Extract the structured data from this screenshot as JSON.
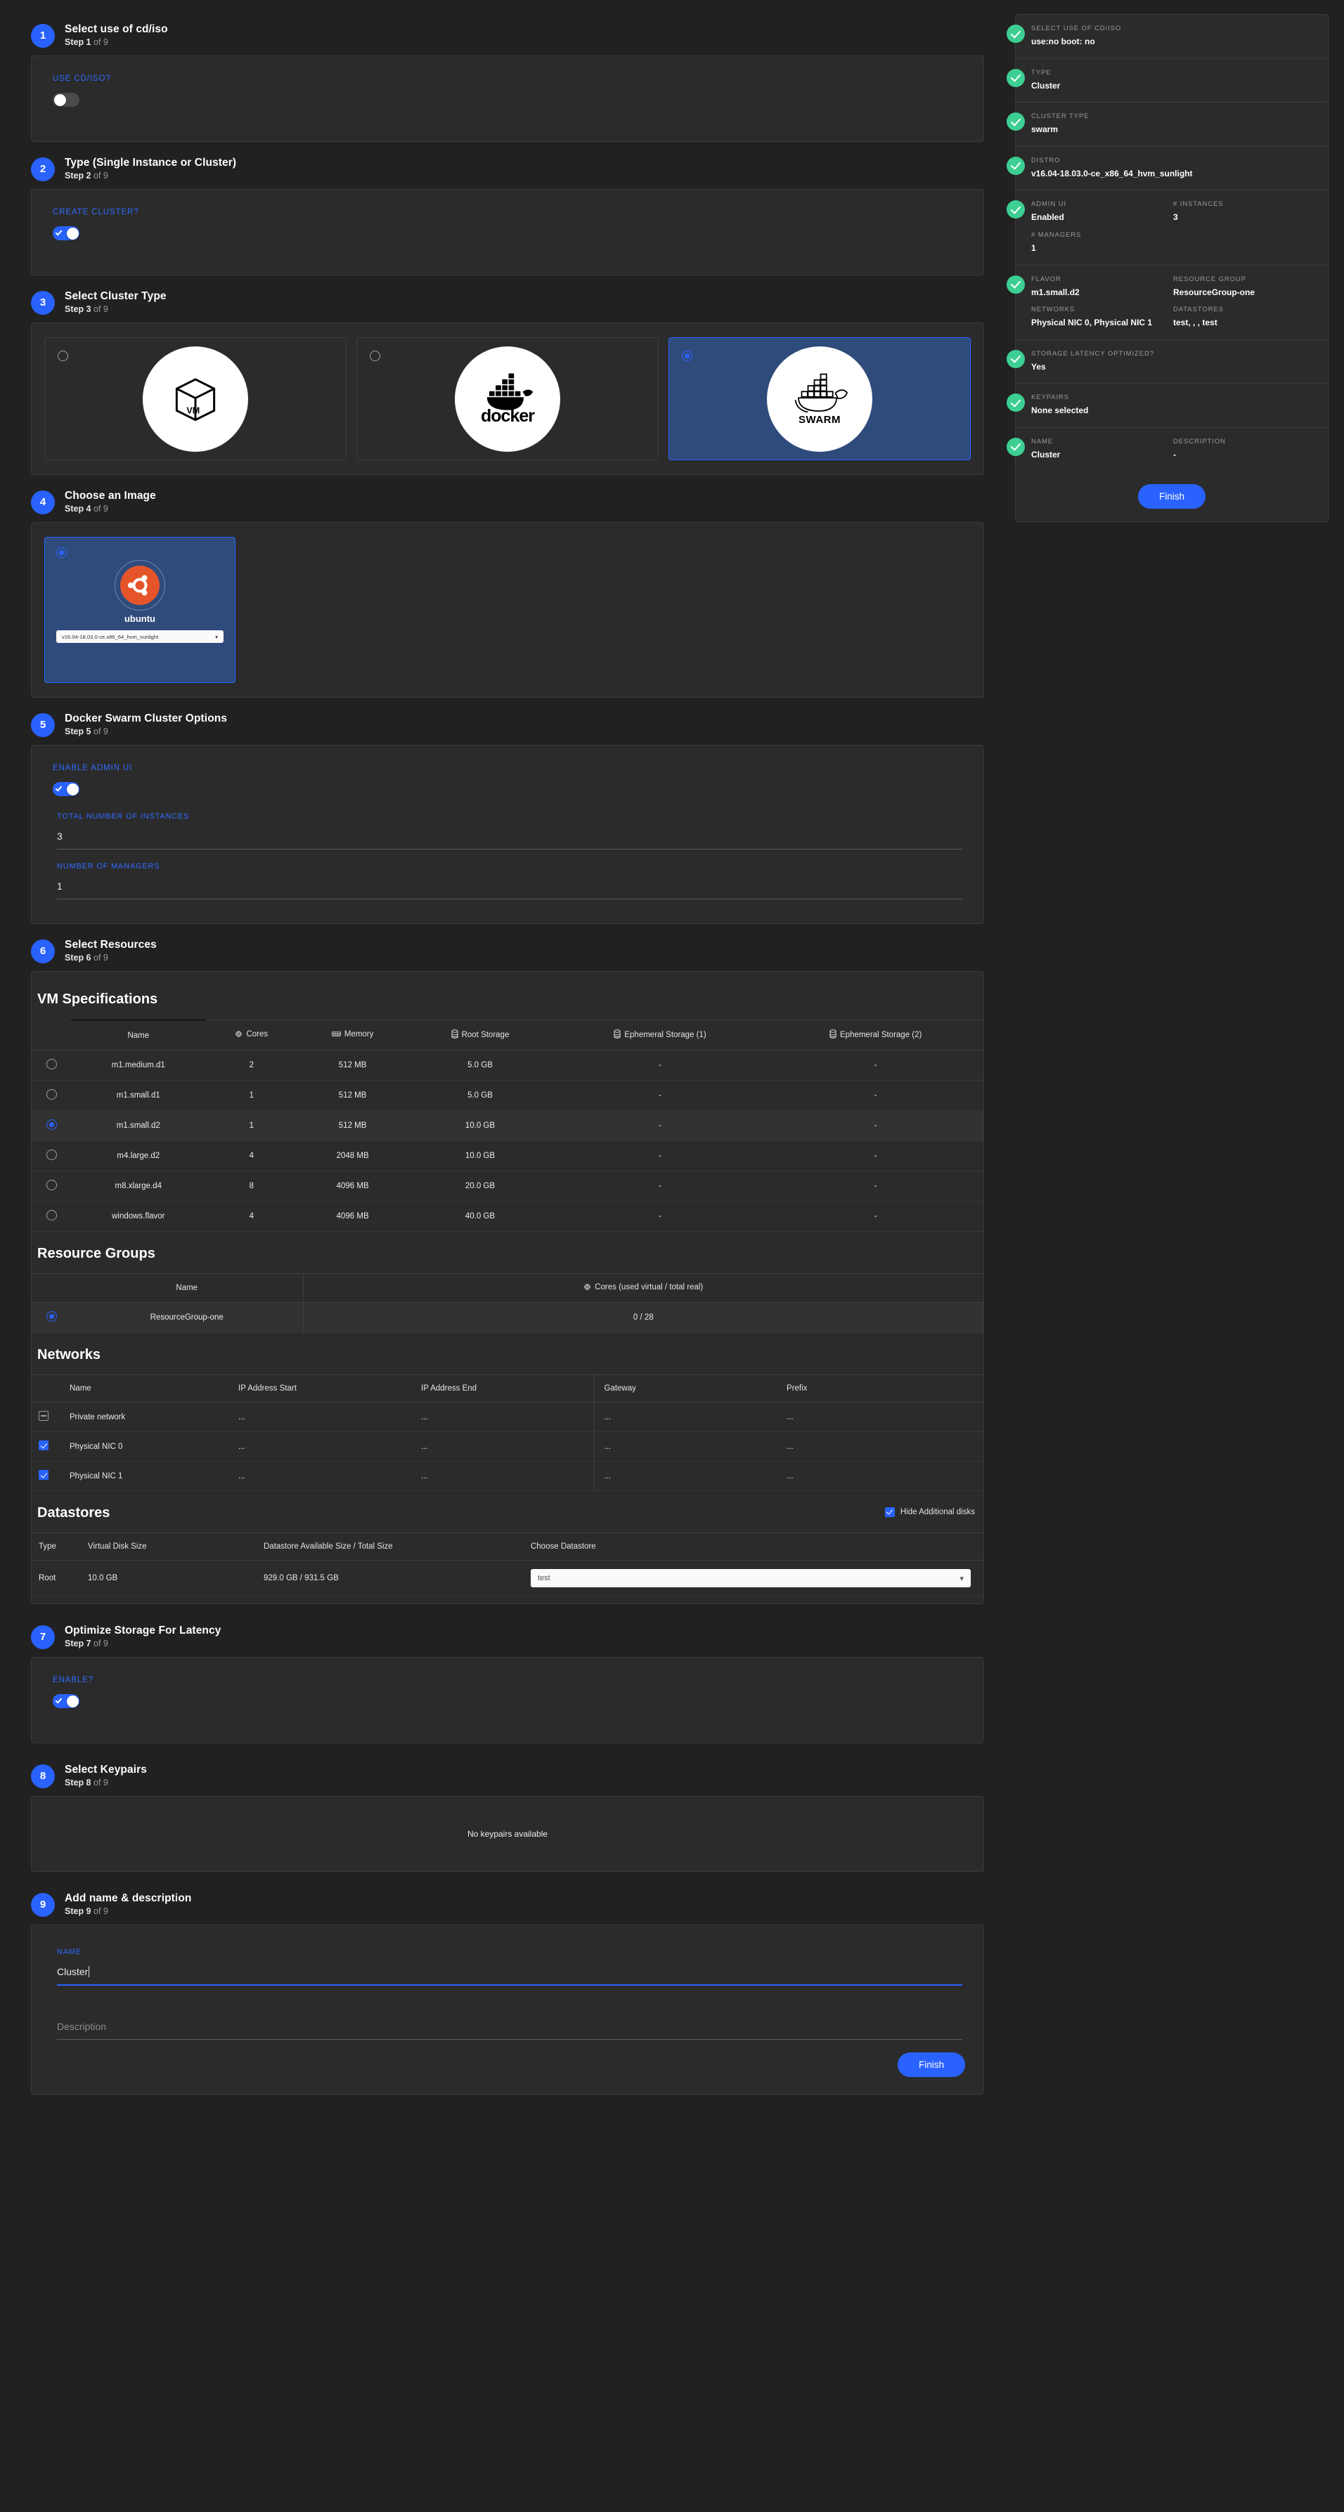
{
  "steps": {
    "total": "9",
    "of_word": "of",
    "step_word": "Step"
  },
  "step1": {
    "num": "1",
    "title": "Select use of cd/iso",
    "step_label": "Step 1",
    "of": "of 9",
    "field_label": "USE CD/ISO?",
    "toggle_state": "off"
  },
  "step2": {
    "num": "2",
    "title": "Type (Single Instance or Cluster)",
    "step_label": "Step 2",
    "of": "of 9",
    "field_label": "CREATE CLUSTER?",
    "toggle_state": "on"
  },
  "step3": {
    "num": "3",
    "title": "Select Cluster Type",
    "step_label": "Step 3",
    "of": "of 9",
    "cards": [
      {
        "id": "vm",
        "label": "VM",
        "selected": false
      },
      {
        "id": "docker",
        "label": "docker",
        "selected": false
      },
      {
        "id": "swarm",
        "label": "SWARM",
        "selected": true
      }
    ]
  },
  "step4": {
    "num": "4",
    "title": "Choose an Image",
    "step_label": "Step 4",
    "of": "of 9",
    "image_name": "ubuntu",
    "version_selected": "v16.04-18.03.0-ce.x86_64_hvm_sunlight",
    "selected": true
  },
  "step5": {
    "num": "5",
    "title": "Docker Swarm Cluster Options",
    "step_label": "Step 5",
    "of": "of 9",
    "admin_ui_label": "ENABLE ADMIN UI",
    "admin_ui_state": "on",
    "instances_label": "TOTAL NUMBER OF INSTANCES",
    "instances_value": "3",
    "managers_label": "NUMBER OF MANAGERS",
    "managers_value": "1"
  },
  "step6": {
    "num": "6",
    "title": "Select Resources",
    "step_label": "Step 6",
    "of": "of 9",
    "vm_specs": {
      "heading": "VM Specifications",
      "columns": [
        "Name",
        "Cores",
        "Memory",
        "Root Storage",
        "Ephemeral Storage (1)",
        "Ephemeral Storage (2)"
      ],
      "rows": [
        {
          "name": "m1.medium.d1",
          "cores": "2",
          "memory": "512 MB",
          "root": "5.0 GB",
          "eph1": "-",
          "eph2": "-",
          "selected": false
        },
        {
          "name": "m1.small.d1",
          "cores": "1",
          "memory": "512 MB",
          "root": "5.0 GB",
          "eph1": "-",
          "eph2": "-",
          "selected": false
        },
        {
          "name": "m1.small.d2",
          "cores": "1",
          "memory": "512 MB",
          "root": "10.0 GB",
          "eph1": "-",
          "eph2": "-",
          "selected": true
        },
        {
          "name": "m4.large.d2",
          "cores": "4",
          "memory": "2048 MB",
          "root": "10.0 GB",
          "eph1": "-",
          "eph2": "-",
          "selected": false
        },
        {
          "name": "m8.xlarge.d4",
          "cores": "8",
          "memory": "4096 MB",
          "root": "20.0 GB",
          "eph1": "-",
          "eph2": "-",
          "selected": false
        },
        {
          "name": "windows.flavor",
          "cores": "4",
          "memory": "4096 MB",
          "root": "40.0 GB",
          "eph1": "-",
          "eph2": "-",
          "selected": false
        }
      ]
    },
    "resource_groups": {
      "heading": "Resource Groups",
      "columns": [
        "Name",
        "Cores (used virtual / total real)"
      ],
      "rows": [
        {
          "name": "ResourceGroup-one",
          "cores": "0 / 28",
          "selected": true
        }
      ]
    },
    "networks": {
      "heading": "Networks",
      "columns": [
        "Name",
        "IP Address Start",
        "IP Address End",
        "Gateway",
        "Prefix"
      ],
      "rows": [
        {
          "name": "Private network",
          "start": "...",
          "end": "...",
          "gateway": "...",
          "prefix": "...",
          "state": "indeterminate"
        },
        {
          "name": "Physical NIC 0",
          "start": "...",
          "end": "...",
          "gateway": "...",
          "prefix": "...",
          "state": "checked"
        },
        {
          "name": "Physical NIC 1",
          "start": "...",
          "end": "...",
          "gateway": "...",
          "prefix": "...",
          "state": "checked"
        }
      ]
    },
    "datastores": {
      "heading": "Datastores",
      "hide_label": "Hide Additional disks",
      "hide_checked": true,
      "columns": [
        "Type",
        "Virtual Disk Size",
        "Datastore Available Size / Total Size",
        "Choose Datastore"
      ],
      "rows": [
        {
          "type": "Root",
          "disk": "10.0 GB",
          "size": "929.0 GB / 931.5 GB",
          "choose": "test"
        }
      ]
    }
  },
  "step7": {
    "num": "7",
    "title": "Optimize Storage For Latency",
    "step_label": "Step 7",
    "of": "of 9",
    "field_label": "ENABLE?",
    "toggle_state": "on"
  },
  "step8": {
    "num": "8",
    "title": "Select Keypairs",
    "step_label": "Step 8",
    "of": "of 9",
    "empty_text": "No keypairs available"
  },
  "step9": {
    "num": "9",
    "title": "Add name & description",
    "step_label": "Step 9",
    "of": "of 9",
    "name_label": "NAME",
    "name_value": "Cluster",
    "description_placeholder": "Description",
    "finish_label": "Finish"
  },
  "summary": {
    "rows": [
      {
        "label": "SELECT USE OF CD/ISO",
        "value": "use:no boot: no"
      },
      {
        "label": "TYPE",
        "value": "Cluster"
      },
      {
        "label": "CLUSTER TYPE",
        "value": "swarm"
      },
      {
        "label": "DISTRO",
        "value": "v16.04-18.03.0-ce_x86_64_hvm_sunlight"
      },
      {
        "label": "ADMIN UI",
        "value": "Enabled",
        "label2": "# INSTANCES",
        "value2": "3",
        "label3": "# MANAGERS",
        "value3": "1"
      },
      {
        "label": "FLAVOR",
        "value": "m1.small.d2",
        "label2": "RESOURCE GROUP",
        "value2": "ResourceGroup-one",
        "label3": "NETWORKS",
        "value3": "Physical NIC 0, Physical NIC 1",
        "label4": "DATASTORES",
        "value4": "test, , , test"
      },
      {
        "label": "STORAGE LATENCY OPTIMIZED?",
        "value": "Yes"
      },
      {
        "label": "KEYPAIRS",
        "value": "None selected"
      },
      {
        "label": "NAME",
        "value": "Cluster",
        "label2": "DESCRIPTION",
        "value2": "-"
      }
    ],
    "finish_label": "Finish"
  },
  "colors": {
    "accent": "#2962ff",
    "success": "#3ccf91",
    "bg": "#212121",
    "card": "#2b2b2b",
    "selected_card": "#2f4b7c",
    "ubuntu_orange": "#e6552a"
  }
}
